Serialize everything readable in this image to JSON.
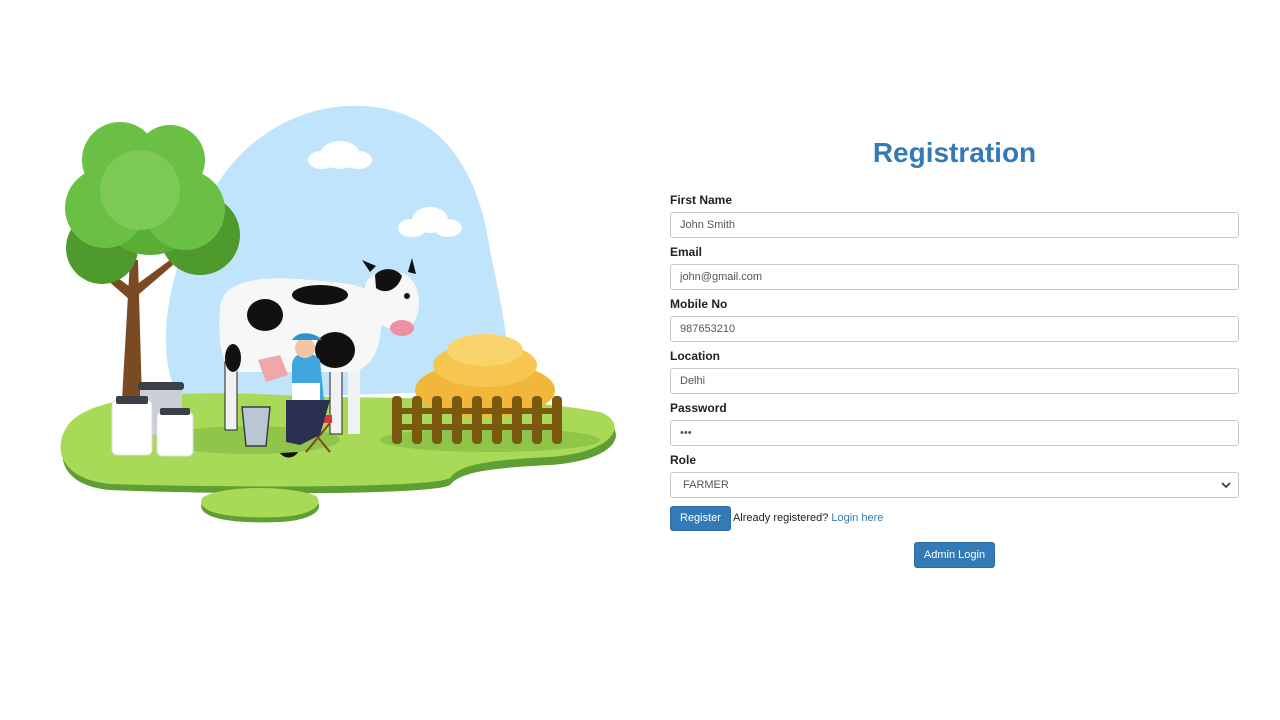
{
  "form": {
    "title": "Registration",
    "fields": [
      {
        "label": "First Name",
        "value": "John Smith",
        "type": "text"
      },
      {
        "label": "Email",
        "value": "john@gmail.com",
        "type": "email"
      },
      {
        "label": "Mobile No",
        "value": "987653210",
        "type": "text"
      },
      {
        "label": "Location",
        "value": "Delhi",
        "type": "text"
      },
      {
        "label": "Password",
        "value": "•••",
        "type": "password"
      }
    ],
    "role": {
      "label": "Role",
      "selected": "FARMER"
    },
    "register_label": "Register",
    "already_text": "Already registered?",
    "login_link": "Login here",
    "admin_login_label": "Admin Login"
  },
  "colors": {
    "primary": "#337ab7",
    "grass": "#9ccc4e",
    "sky": "#bfe4fb",
    "tree": "#6abf45"
  },
  "illustration": {
    "icon": "dairy-farm-illustration"
  }
}
